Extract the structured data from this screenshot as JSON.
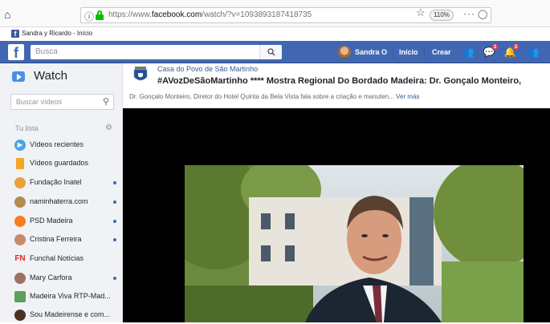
{
  "browser": {
    "url_prefix": "https://www.",
    "url_domain": "facebook.com",
    "url_path": "/watch/?v=1093893187418735",
    "zoom": "110%",
    "more_label": "···",
    "tab_title": "Sandra y Ricardo - Início"
  },
  "fb": {
    "logo": "f",
    "search_placeholder": "Busca",
    "user_name": "Sandra O",
    "nav_home": "Início",
    "nav_create": "Crear",
    "messages_badge": "1",
    "notifications_badge": "3",
    "brand_color": "#4267b2"
  },
  "sidebar": {
    "title": "Watch",
    "search_placeholder": "Buscar vídeos",
    "list_header": "Tu lista",
    "items": [
      {
        "label": "Vídeos recientes",
        "icon": "play-icon",
        "color": "#4aa3df"
      },
      {
        "label": "Vídeos guardados",
        "icon": "bookmark-icon",
        "color": "#f5a623"
      },
      {
        "label": "Fundação Inatel",
        "icon": "inatel-avatar",
        "color": "#e8a23b"
      },
      {
        "label": "naminhaterra.com",
        "icon": "naminhaterra-avatar",
        "color": "#b38b4d"
      },
      {
        "label": "PSD Madeira",
        "icon": "psd-avatar",
        "color": "#f57c1f"
      },
      {
        "label": "Cristina Ferreira",
        "icon": "cristina-avatar",
        "color": "#c68b6b"
      },
      {
        "label": "Funchal Notícias",
        "icon": "fn-logo",
        "color": "#e02b2b"
      },
      {
        "label": "Mary Carfora",
        "icon": "mary-avatar",
        "color": "#a07060"
      },
      {
        "label": "Madeira Viva RTP-Mad...",
        "icon": "madeira-viva-avatar",
        "color": "#5aa05a"
      },
      {
        "label": "Sou Madeirense e com...",
        "icon": "sou-madeirense-avatar",
        "color": "#4a3020"
      }
    ]
  },
  "video": {
    "page_name": "Casa do Povo de São Martinho",
    "title": "#AVozDeSãoMartinho **** Mostra Regional Do Bordado Madeira: Dr. Gonçalo Monteiro,",
    "description": "Dr. Gonçalo Monteiro, Diretor do Hotel Quinta da Bela Vista fala sobre a criação e manuten...",
    "see_more": "Ver más"
  }
}
